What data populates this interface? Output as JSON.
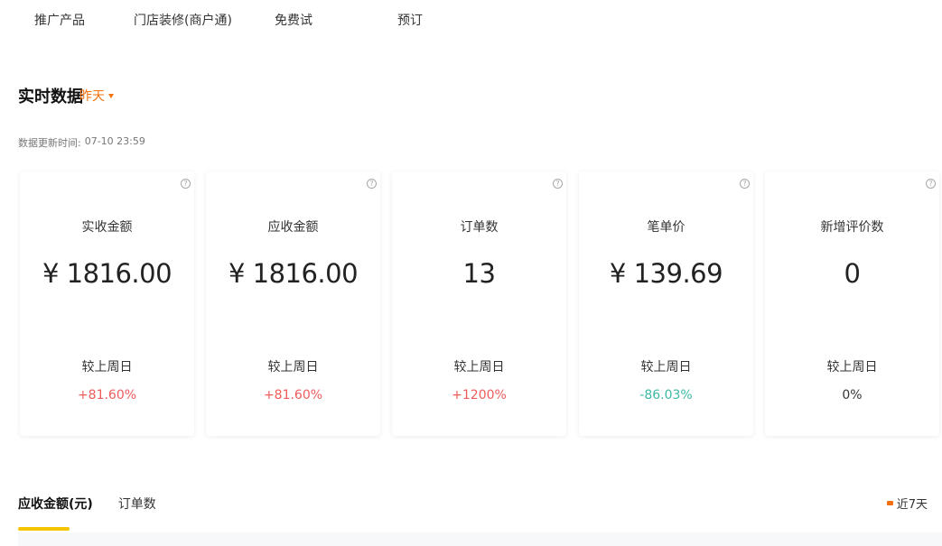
{
  "nav": {
    "items": [
      {
        "label": "推广产品"
      },
      {
        "label": "门店装修(商户通)"
      },
      {
        "label": "免费试"
      },
      {
        "label": "预订"
      }
    ]
  },
  "realtime": {
    "title": "实时数据",
    "period": "昨天",
    "update_label": "数据更新时间:",
    "update_time": "07-10 23:59"
  },
  "cards": [
    {
      "label": "实收金额",
      "value": "¥ 1816.00",
      "compare_label": "较上周日",
      "compare_value": "+81.60%"
    },
    {
      "label": "应收金额",
      "value": "¥ 1816.00",
      "compare_label": "较上周日",
      "compare_value": "+81.60%"
    },
    {
      "label": "订单数",
      "value": "13",
      "compare_label": "较上周日",
      "compare_value": "+1200%"
    },
    {
      "label": "笔单价",
      "value": "¥ 139.69",
      "compare_label": "较上周日",
      "compare_value": "-86.03%"
    },
    {
      "label": "新增评价数",
      "value": "0",
      "compare_label": "较上周日",
      "compare_value": "0%"
    }
  ],
  "colors": {
    "accent": "#f2700e",
    "tab_underline": "#f5c400",
    "up": "#ef5b5b",
    "down": "#3cb8a4",
    "neutral": "#333333"
  },
  "chart_tabs": [
    {
      "label": "应收金额(元)"
    },
    {
      "label": "订单数"
    }
  ],
  "range": {
    "label": "近7天"
  }
}
